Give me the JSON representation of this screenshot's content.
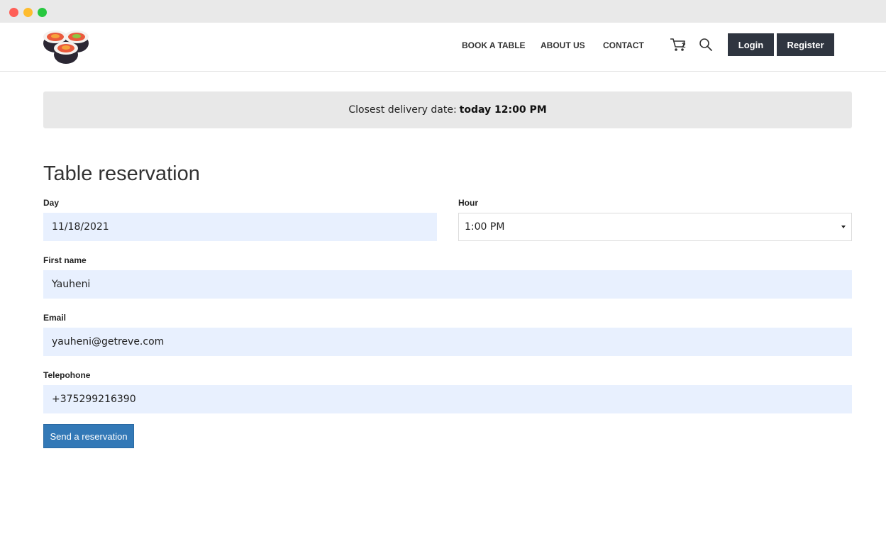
{
  "nav": {
    "book_a_table": "BOOK A TABLE",
    "about_us": "ABOUT US",
    "contact": "CONTACT",
    "cart_count": "2",
    "login": "Login",
    "register": "Register"
  },
  "delivery": {
    "label": "Closest delivery date:",
    "value": "today 12:00 PM"
  },
  "form": {
    "title": "Table reservation",
    "day_label": "Day",
    "day_value": "11/18/2021",
    "hour_label": "Hour",
    "hour_value": "1:00 PM",
    "first_name_label": "First name",
    "first_name_value": "Yauheni",
    "email_label": "Email",
    "email_value": "yauheni@getreve.com",
    "phone_label": "Telepohone",
    "phone_value": "+375299216390",
    "submit_label": "Send a reservation"
  },
  "icons": {
    "logo": "sushi-rolls-logo",
    "cart": "cart-icon",
    "search": "search-icon",
    "select_caret": "caret-down-icon"
  },
  "colors": {
    "dark_button": "#2f3540",
    "primary_button": "#3379b7",
    "input_fill": "#e8f0fe",
    "banner_bg": "#e8e8e8"
  }
}
